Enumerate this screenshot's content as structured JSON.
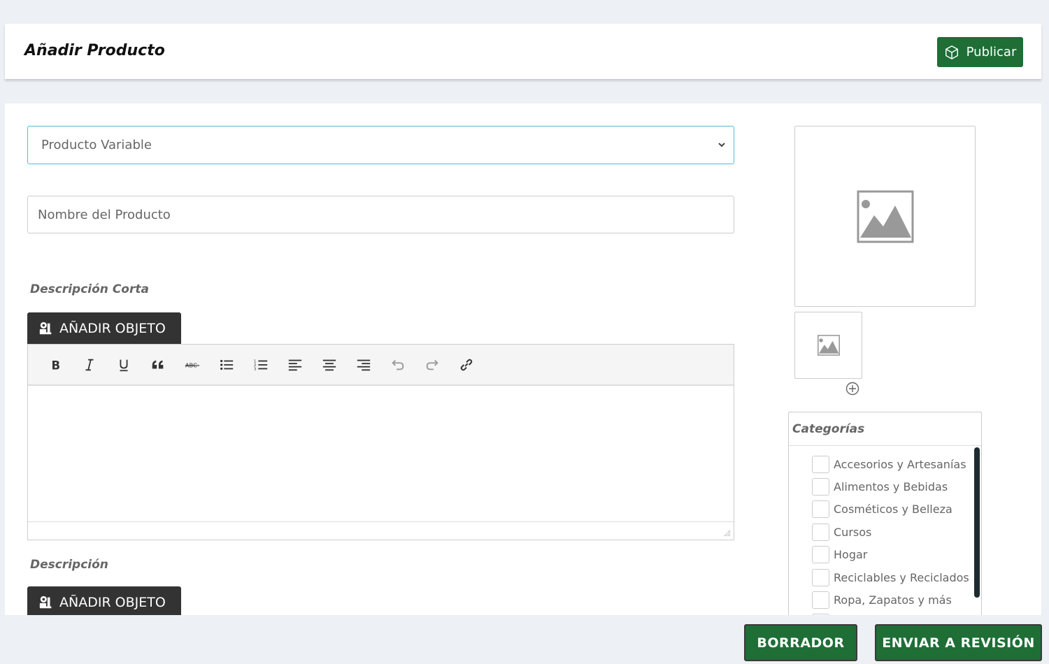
{
  "header": {
    "title": "Añadir Producto",
    "publish_label": "Publicar"
  },
  "form": {
    "product_type": {
      "selected": "Producto Variable"
    },
    "product_name": {
      "placeholder": "Nombre del Producto",
      "value": ""
    },
    "short_description": {
      "label": "Descripción Corta",
      "add_object_label": "AÑADIR OBJETO"
    },
    "description": {
      "label": "Descripción",
      "add_object_label": "AÑADIR OBJETO"
    },
    "editor_toolbar": [
      "bold-icon",
      "italic-icon",
      "underline-icon",
      "blockquote-icon",
      "strikethrough-icon",
      "bullet-list-icon",
      "numbered-list-icon",
      "align-left-icon",
      "align-center-icon",
      "align-right-icon",
      "undo-icon",
      "redo-icon",
      "link-icon"
    ]
  },
  "categories": {
    "title": "Categorías",
    "items": [
      "Accesorios y Artesanías",
      "Alimentos y Bebidas",
      "Cosméticos y Belleza",
      "Cursos",
      "Hogar",
      "Reciclables y Reciclados",
      "Ropa, Zapatos y más"
    ]
  },
  "footer": {
    "draft_label": "BORRADOR",
    "submit_label": "ENVIAR A REVISIÓN"
  },
  "colors": {
    "accent_green": "#1e6e36",
    "select_border": "#5bb7d8",
    "dark_button": "#333333"
  }
}
